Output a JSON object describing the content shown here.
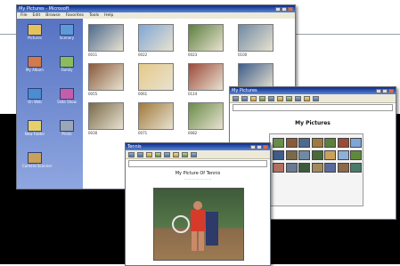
{
  "main_window": {
    "title": "My Pictures - Microsoft",
    "menu": [
      "File",
      "Edit",
      "Browse",
      "Favorites",
      "Tools",
      "Help"
    ],
    "sidebar": [
      {
        "label": "Pictures",
        "icon": "folder-icon",
        "color": "#e6c25c"
      },
      {
        "label": "Scenery",
        "icon": "picture-icon",
        "color": "#5f9ad8"
      },
      {
        "label": "My Album",
        "icon": "album-icon",
        "color": "#d27a4a"
      },
      {
        "label": "Family",
        "icon": "people-icon",
        "color": "#8bbc5c"
      },
      {
        "label": "On Web",
        "icon": "globe-icon",
        "color": "#4a8ed0"
      },
      {
        "label": "Slide Show",
        "icon": "slideshow-icon",
        "color": "#c45ea8"
      },
      {
        "label": "New Folder",
        "icon": "new-folder-icon",
        "color": "#e6d06a"
      },
      {
        "label": "Prints",
        "icon": "printer-icon",
        "color": "#9aa7b5"
      },
      {
        "label": "Camera Scanner",
        "icon": "camera-icon",
        "color": "#c9a15a"
      }
    ],
    "thumbnails": [
      {
        "caption": "0011",
        "color": "#4d6a8f"
      },
      {
        "caption": "0022",
        "color": "#7fa6d6"
      },
      {
        "caption": "0023",
        "color": "#5c7f3e"
      },
      {
        "caption": "0100",
        "color": "#6f8aa3"
      },
      {
        "caption": "0055",
        "color": "#8a5a3c"
      },
      {
        "caption": "0061",
        "color": "#e6c98a"
      },
      {
        "caption": "0124",
        "color": "#9c4a3a"
      },
      {
        "caption": "0019",
        "color": "#3e5d8a"
      },
      {
        "caption": "0030",
        "color": "#7a6a4a"
      },
      {
        "caption": "0071",
        "color": "#a07a3c"
      },
      {
        "caption": "0082",
        "color": "#6a8c4a"
      },
      {
        "caption": "0092",
        "color": "#4a6a3a"
      }
    ]
  },
  "album_window": {
    "title": "My Pictures",
    "heading": "My Pictures",
    "strip_colors": [
      "#6a8c4a",
      "#8a5a3c",
      "#4d6a8f",
      "#a07a3c",
      "#5c7f3e",
      "#9c4a3a",
      "#7fa6d6",
      "#3e5d8a",
      "#7a6a4a",
      "#6f8aa3",
      "#4a6a3a",
      "#c9a15a",
      "#8fb0d8",
      "#5f8a3c",
      "#b07060",
      "#6a7a90",
      "#3c5a3c",
      "#a08a5a",
      "#5a6a9a",
      "#8a6a4a",
      "#4a7a6a"
    ]
  },
  "photo_window": {
    "title": "Tennis",
    "heading": "My Picture Of Tennis",
    "subtitle": "........................"
  }
}
